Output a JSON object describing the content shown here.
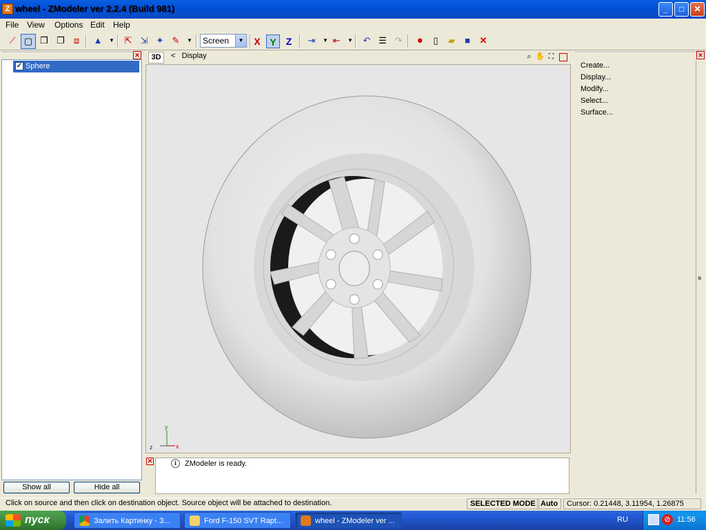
{
  "window": {
    "title": "wheel - ZModeler ver 2.2.4 (Build 981)",
    "app_icon": "Z",
    "controls": {
      "minimize": "_",
      "maximize": "□",
      "close": "✕"
    }
  },
  "menu": [
    "File",
    "View",
    "Options",
    "Edit",
    "Help"
  ],
  "toolbar": {
    "view_mode_select": "Screen",
    "axes": {
      "x": "X",
      "y": "Y",
      "z": "Z"
    },
    "colors": {
      "x": "#c00000",
      "y": "#008000",
      "z": "#0000c0"
    }
  },
  "left_panel": {
    "tree_items": [
      {
        "label": "Sphere",
        "checked": true
      }
    ],
    "show_all": "Show all",
    "hide_all": "Hide all"
  },
  "viewport": {
    "tab": "3D",
    "nav_prev": "<",
    "title": "Display",
    "axis_labels": {
      "z": "z",
      "y": "y",
      "x": "x"
    }
  },
  "console": {
    "message": "ZModeler is ready."
  },
  "right_panel": {
    "commands": [
      "Create...",
      "Display...",
      "Modify...",
      "Select...",
      "Surface..."
    ]
  },
  "statusbar": {
    "message": "Click on source and then click on destination object. Source object will be attached to destination.",
    "mode": "SELECTED MODE",
    "auto": "Auto",
    "cursor": "Cursor: 0.21448, 3.11954, 1.26875"
  },
  "taskbar": {
    "start": "пуск",
    "tasks": [
      "Залить Картинку - З...",
      "Ford F-150 SVT Rapt...",
      "wheel - ZModeler ver ..."
    ],
    "language": "RU",
    "clock": "11:56"
  }
}
